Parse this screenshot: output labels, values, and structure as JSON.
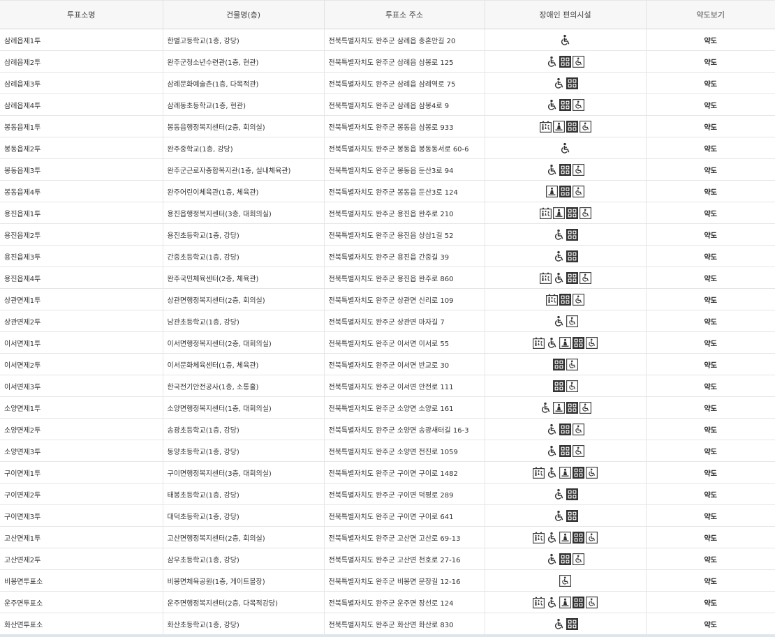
{
  "headers": [
    "투표소명",
    "건물명(층)",
    "투표소 주소",
    "장애인 편의시설",
    "약도보기"
  ],
  "map_label": "약도",
  "rows": [
    {
      "name": "삼례읍제1투",
      "building": "한별고등학교(1층, 강당)",
      "address": "전북특별자치도 완주군 삼례읍 충혼안길 20",
      "icons": [
        "wheelchair-icon"
      ]
    },
    {
      "name": "삼례읍제2투",
      "building": "완주군청소년수련관(1층, 현관)",
      "address": "전북특별자치도 완주군 삼례읍 삼봉로 125",
      "icons": [
        "wheelchair-icon",
        "braille-icon",
        "wheelchair-box-icon"
      ]
    },
    {
      "name": "삼례읍제3투",
      "building": "삼례문화예술촌(1층, 다목적관)",
      "address": "전북특별자치도 완주군 삼례읍 삼례역로 75",
      "icons": [
        "wheelchair-icon",
        "braille-icon"
      ]
    },
    {
      "name": "삼례읍제4투",
      "building": "삼례동초등학교(1층, 현관)",
      "address": "전북특별자치도 완주군 삼례읍 삼봉4로 9",
      "icons": [
        "wheelchair-icon",
        "braille-icon",
        "wheelchair-box-icon"
      ]
    },
    {
      "name": "봉동읍제1투",
      "building": "봉동읍행정복지센터(2층, 회의실)",
      "address": "전북특별자치도 완주군 봉동읍 삼봉로 933",
      "icons": [
        "restroom-icon",
        "elevator-icon",
        "braille-icon",
        "wheelchair-box-icon"
      ]
    },
    {
      "name": "봉동읍제2투",
      "building": "완주중학교(1층, 강당)",
      "address": "전북특별자치도 완주군 봉동읍 봉동동서로 60-6",
      "icons": [
        "wheelchair-icon"
      ]
    },
    {
      "name": "봉동읍제3투",
      "building": "완주군근로자종합복지관(1층, 실내체육관)",
      "address": "전북특별자치도 완주군 봉동읍 둔산3로 94",
      "icons": [
        "wheelchair-icon",
        "braille-icon",
        "wheelchair-box-icon"
      ]
    },
    {
      "name": "봉동읍제4투",
      "building": "완주어린이체육관(1층, 체육관)",
      "address": "전북특별자치도 완주군 봉동읍 둔산3로 124",
      "icons": [
        "elevator-icon",
        "braille-icon",
        "wheelchair-box-icon"
      ]
    },
    {
      "name": "용진읍제1투",
      "building": "용진읍행정복지센터(3층, 대회의실)",
      "address": "전북특별자치도 완주군 용진읍 완주로 210",
      "icons": [
        "restroom-icon",
        "elevator-icon",
        "braille-icon",
        "wheelchair-box-icon"
      ]
    },
    {
      "name": "용진읍제2투",
      "building": "용진초등학교(1층, 강당)",
      "address": "전북특별자치도 완주군 용진읍 상삼1길 52",
      "icons": [
        "wheelchair-icon",
        "braille-icon"
      ]
    },
    {
      "name": "용진읍제3투",
      "building": "간중초등학교(1층, 강당)",
      "address": "전북특별자치도 완주군 용진읍 간중길 39",
      "icons": [
        "wheelchair-icon",
        "braille-icon"
      ]
    },
    {
      "name": "용진읍제4투",
      "building": "완주국민체육센터(2층, 체육관)",
      "address": "전북특별자치도 완주군 용진읍 완주로 860",
      "icons": [
        "restroom-icon",
        "wheelchair-icon",
        "braille-icon",
        "wheelchair-box-icon"
      ]
    },
    {
      "name": "상관면제1투",
      "building": "상관면행정복지센터(2층, 회의실)",
      "address": "전북특별자치도 완주군 상관면 신리로 109",
      "icons": [
        "restroom-icon",
        "braille-icon",
        "wheelchair-box-icon"
      ]
    },
    {
      "name": "상관면제2투",
      "building": "남관초등학교(1층, 강당)",
      "address": "전북특별자치도 완주군 상관면 마자길 7",
      "icons": [
        "wheelchair-icon",
        "wheelchair-box-icon"
      ]
    },
    {
      "name": "이서면제1투",
      "building": "이서면행정복지센터(2층, 대회의실)",
      "address": "전북특별자치도 완주군 이서면 이서로 55",
      "icons": [
        "restroom-icon",
        "wheelchair-icon",
        "elevator-icon",
        "braille-icon",
        "wheelchair-box-icon"
      ]
    },
    {
      "name": "이서면제2투",
      "building": "이서문화체육센터(1층, 체육관)",
      "address": "전북특별자치도 완주군 이서면 반교로 30",
      "icons": [
        "braille-icon",
        "wheelchair-box-icon"
      ]
    },
    {
      "name": "이서면제3투",
      "building": "한국전기안전공사(1층, 소통홀)",
      "address": "전북특별자치도 완주군 이서면 안전로 111",
      "icons": [
        "braille-icon",
        "wheelchair-box-icon"
      ]
    },
    {
      "name": "소양면제1투",
      "building": "소양면행정복지센터(1층, 대회의실)",
      "address": "전북특별자치도 완주군 소양면 소양로 161",
      "icons": [
        "wheelchair-icon",
        "elevator-icon",
        "braille-icon",
        "wheelchair-box-icon"
      ]
    },
    {
      "name": "소양면제2투",
      "building": "송광초등학교(1층, 강당)",
      "address": "전북특별자치도 완주군 소양면 송광새터길 16-3",
      "icons": [
        "wheelchair-icon",
        "braille-icon",
        "wheelchair-box-icon"
      ]
    },
    {
      "name": "소양면제3투",
      "building": "동양초등학교(1층, 강당)",
      "address": "전북특별자치도 완주군 소양면 전진로 1059",
      "icons": [
        "wheelchair-icon",
        "braille-icon",
        "wheelchair-box-icon"
      ]
    },
    {
      "name": "구이면제1투",
      "building": "구이면행정복지센터(3층, 대회의실)",
      "address": "전북특별자치도 완주군 구이면 구이로 1482",
      "icons": [
        "restroom-icon",
        "wheelchair-icon",
        "elevator-icon",
        "braille-icon",
        "wheelchair-box-icon"
      ]
    },
    {
      "name": "구이면제2투",
      "building": "태봉초등학교(1층, 강당)",
      "address": "전북특별자치도 완주군 구이면 덕평로 289",
      "icons": [
        "wheelchair-icon",
        "braille-icon"
      ]
    },
    {
      "name": "구이면제3투",
      "building": "대덕초등학교(1층, 강당)",
      "address": "전북특별자치도 완주군 구이면 구이로 641",
      "icons": [
        "wheelchair-icon",
        "braille-icon"
      ]
    },
    {
      "name": "고산면제1투",
      "building": "고산면행정복지센터(2층, 회의실)",
      "address": "전북특별자치도 완주군 고산면 고산로 69-13",
      "icons": [
        "restroom-icon",
        "wheelchair-icon",
        "elevator-icon",
        "braille-icon",
        "wheelchair-box-icon"
      ]
    },
    {
      "name": "고산면제2투",
      "building": "삼우초등학교(1층, 강당)",
      "address": "전북특별자치도 완주군 고산면 천호로 27-16",
      "icons": [
        "wheelchair-icon",
        "braille-icon",
        "wheelchair-box-icon"
      ]
    },
    {
      "name": "비봉면투표소",
      "building": "비봉면체육공원(1층, 게이트볼장)",
      "address": "전북특별자치도 완주군 비봉면 문장길 12-16",
      "icons": [
        "wheelchair-box-icon"
      ]
    },
    {
      "name": "운주면투표소",
      "building": "운주면행정복지센터(2층, 다목적강당)",
      "address": "전북특별자치도 완주군 운주면 장선로 124",
      "icons": [
        "restroom-icon",
        "wheelchair-icon",
        "elevator-icon",
        "braille-icon",
        "wheelchair-box-icon"
      ]
    },
    {
      "name": "화산면투표소",
      "building": "화산초등학교(1층, 강당)",
      "address": "전북특별자치도 완주군 화산면 화산로 830",
      "icons": [
        "wheelchair-icon",
        "braille-icon"
      ]
    }
  ]
}
